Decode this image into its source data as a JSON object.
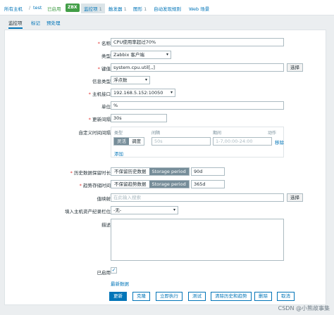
{
  "nav": {
    "all_hosts": "所有主机",
    "sep": "/",
    "host": "test",
    "enabled": "已启用",
    "zbx": "ZBX",
    "items": "监控项",
    "items_count": "1",
    "triggers": "触发器",
    "triggers_count": "1",
    "graphs": "图形",
    "graphs_count": "1",
    "discovery": "自动发现规则",
    "web": "Web 场景"
  },
  "subtabs": [
    "监控项",
    "标记",
    "预处理"
  ],
  "form": {
    "name_label": "名称",
    "name_value": "CPU使用率超过70%",
    "type_label": "类型",
    "type_value": "Zabbix 客户端",
    "key_label": "键值",
    "key_value": "system.cpu.util[,,]",
    "select_btn": "选择",
    "info_type_label": "信息类型",
    "info_type_value": "浮点数",
    "iface_label": "主机接口",
    "iface_value": "192.168.5.152:10050",
    "unit_label": "单位",
    "unit_value": "%",
    "interval_label": "更新间隔",
    "interval_value": "30s",
    "custom_label": "自定义时间间隔",
    "sched": {
      "col_type": "类型",
      "col_interval": "间隔",
      "col_period": "期间",
      "col_action": "动作",
      "flex": "灵活",
      "scheduling": "调度",
      "interval_ph": "50s",
      "period_ph": "1-7,00:00-24:00",
      "remove": "移除",
      "add": "添加"
    },
    "history_label": "历史数据保留时长",
    "no_keep": "不保留历史数据",
    "storage": "Storage period",
    "history_value": "90d",
    "trend_label": "趋势存储时间",
    "no_keep_trend": "不保留趋势数据",
    "trend_value": "365d",
    "valuemap_label": "值映射",
    "valuemap_ph": "在此输入搜索",
    "inventory_label": "填入主机资产纪录栏位",
    "inventory_value": "-无-",
    "desc_label": "描述",
    "enabled_label": "已启用",
    "latest": "最新数据"
  },
  "actions": [
    "更新",
    "克隆",
    "立即执行",
    "测试",
    "清除历史和趋势",
    "删除",
    "取消"
  ],
  "watermark": "CSDN @小熊故事集"
}
